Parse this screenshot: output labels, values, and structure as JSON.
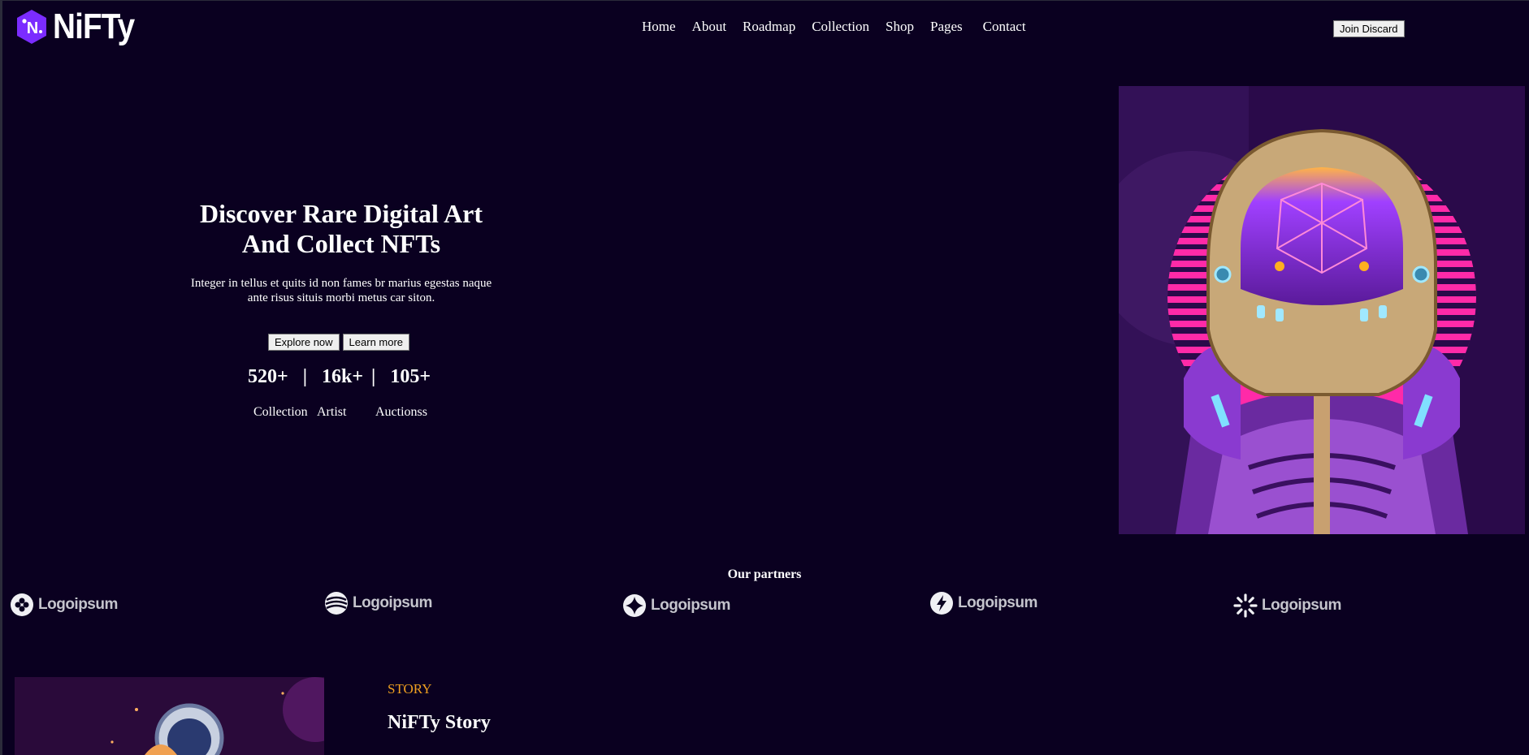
{
  "brand": {
    "mark_letter": "N",
    "name": "NiFTy",
    "accent": "#7b2cff"
  },
  "nav": {
    "items": [
      "Home",
      "About",
      "Roadmap",
      "Collection",
      "Shop",
      "Pages",
      "Contact"
    ],
    "join_label": "Join Discard"
  },
  "hero": {
    "title_line1": "Discover Rare Digital Art",
    "title_line2": "And Collect NFTs",
    "desc_line1": "Integer in tellus et quits id non fames br marius egestas naque",
    "desc_line2": "ante risus situis morbi metus car siton.",
    "explore_label": "Explore now",
    "learn_label": "Learn more",
    "stats": [
      {
        "value": "520+",
        "label": "Collection"
      },
      {
        "value": "16k+",
        "label": "Artist"
      },
      {
        "value": "105+",
        "label": "Auctionss"
      }
    ],
    "separator": "|"
  },
  "partners": {
    "title": "Our partners",
    "items": [
      {
        "name": "Logoipsum",
        "icon": "flower-icon"
      },
      {
        "name": "Logoipsum",
        "icon": "waves-icon"
      },
      {
        "name": "Logoipsum",
        "icon": "sparkle-icon"
      },
      {
        "name": "Logoipsum",
        "icon": "lightning-icon"
      },
      {
        "name": "Logoipsum",
        "icon": "burst-icon"
      }
    ]
  },
  "story": {
    "eyebrow": "STORY",
    "title": "NiFTy Story",
    "eyebrow_color": "#f0a020"
  }
}
